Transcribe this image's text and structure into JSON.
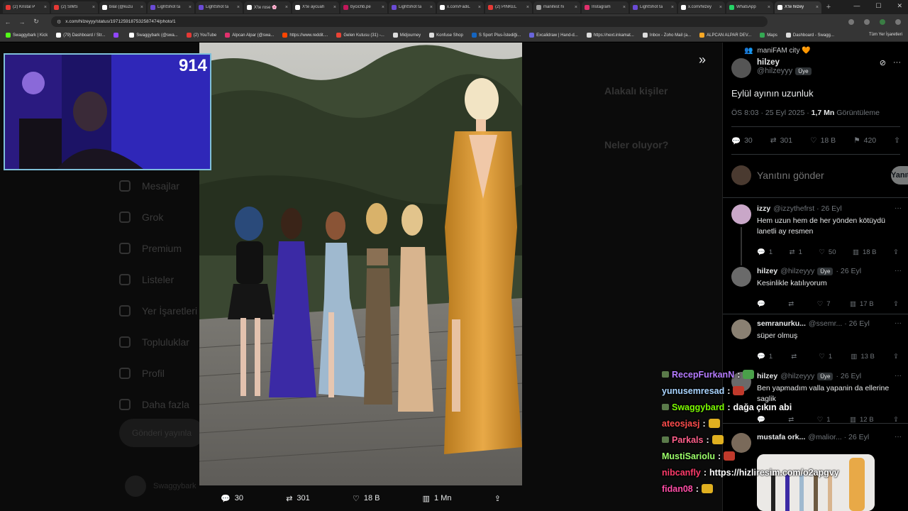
{
  "browser": {
    "tabs": [
      {
        "title": "(2) Kristal P",
        "color": "#e53935"
      },
      {
        "title": "(2) SIMS",
        "color": "#e53935"
      },
      {
        "title": "bilal (@kuzu",
        "color": "#ffffff"
      },
      {
        "title": "LightShot ta",
        "color": "#6a4bd6"
      },
      {
        "title": "LightShot ta",
        "color": "#6a4bd6"
      },
      {
        "title": "X'te rose 🌸",
        "color": "#ffffff"
      },
      {
        "title": "X'te aycuah",
        "color": "#ffffff"
      },
      {
        "title": "bycichb.pe",
        "color": "#c2185b"
      },
      {
        "title": "LightShot ta",
        "color": "#6a4bd6"
      },
      {
        "title": "x.com/FadiL",
        "color": "#ffffff"
      },
      {
        "title": "(2) PINKEL",
        "color": "#e53935"
      },
      {
        "title": "manifest hi",
        "color": "#9e9e9e"
      },
      {
        "title": "Instagram",
        "color": "#e1306c"
      },
      {
        "title": "LightShot ta",
        "color": "#6a4bd6"
      },
      {
        "title": "x.com/hilzey",
        "color": "#ffffff"
      },
      {
        "title": "WhatsApp",
        "color": "#25d366"
      },
      {
        "title": "X'te hilzey",
        "color": "#ffffff",
        "active": true
      }
    ],
    "url": "x.com/hilzeyyy/status/1971259187532587474/photo/1",
    "bookmarks": [
      {
        "label": "Swaggybark | Kick",
        "color": "#53fc18"
      },
      {
        "label": "(79) Dashboard / Str...",
        "color": "#ffffff"
      },
      {
        "label": "",
        "color": "#9146ff"
      },
      {
        "label": "Swaggybark (@swa...",
        "color": "#ffffff"
      },
      {
        "label": "(2) YouTube",
        "color": "#e53935"
      },
      {
        "label": "Alpcan Alpar (@swa...",
        "color": "#e1306c"
      },
      {
        "label": "https://www.reddit....",
        "color": "#ff4500"
      },
      {
        "label": "Gelen Kutusu (31) -...",
        "color": "#ea4335"
      },
      {
        "label": "Midjourney",
        "color": "#dddddd"
      },
      {
        "label": "Konfuse Shop",
        "color": "#dddddd"
      },
      {
        "label": "S Sport Plus-İstediği...",
        "color": "#1565c0"
      },
      {
        "label": "Excalidraw | Hand-d...",
        "color": "#6965db"
      },
      {
        "label": "https://next.inkamat...",
        "color": "#dddddd"
      },
      {
        "label": "Inbox - Zoho Mail (a...",
        "color": "#dddddd"
      },
      {
        "label": "ALPCAN ALPAR DEV...",
        "color": "#f9a825"
      },
      {
        "label": "Maps",
        "color": "#34a853"
      },
      {
        "label": "Dashboard - Swagg...",
        "color": "#dddddd"
      }
    ],
    "all_bookmarks": "Tüm Yer İşaretleri"
  },
  "background_nav": [
    "Mesajlar",
    "Grok",
    "Premium",
    "Listeler",
    "Yer İşaretleri",
    "Topluluklar",
    "Profil",
    "Daha fazla"
  ],
  "background_post_button": "Gönderi yayınla",
  "background_account": "Swaggybark",
  "background_right": {
    "related": "Alakalı kişiler",
    "trending": "Neler oluyor?"
  },
  "webcam": {
    "counter": "914"
  },
  "photo_bar": {
    "replies": "30",
    "reposts": "301",
    "likes": "18 B",
    "views": "1 Mn"
  },
  "tweet": {
    "community": "maniFAM city 🧡",
    "author_name": "hilzey",
    "author_handle": "@hilzeyyy",
    "member_badge": "Üye",
    "text": "Eylül ayının uzunluk",
    "time": "ÖS 8:03 · 25 Eyl 2025 · ",
    "views": "1,7 Mn",
    "views_label": " Görüntüleme",
    "replies": "30",
    "reposts": "301",
    "likes": "18 B",
    "bookmarks": "420",
    "reply_placeholder": "Yanıtını gönder",
    "reply_button": "Yanıtla"
  },
  "replies": [
    {
      "name": "izzy",
      "handle": "@izzythefrst · 26 Eyl",
      "text": "Hem uzun hem de her yönden kötüydü lanetli ay resmen",
      "replies": "1",
      "reposts": "1",
      "likes": "50",
      "views": "18 B",
      "avatar_color": "#c9a7c8"
    },
    {
      "name": "hilzey",
      "handle": "@hilzeyyy",
      "badge": "Üye",
      "date": "· 26 Eyl",
      "text": "Kesinlikle katılıyorum",
      "replies": "",
      "reposts": "",
      "likes": "7",
      "views": "17 B",
      "avatar_color": "#6a6a6a"
    },
    {
      "name": "semranurku...",
      "handle": "@ssemr... · 26 Eyl",
      "text": "süper olmuş",
      "replies": "1",
      "reposts": "",
      "likes": "1",
      "views": "13 B",
      "avatar_color": "#8a8072"
    },
    {
      "name": "hilzey",
      "handle": "@hilzeyyy",
      "badge": "Üye",
      "date": "· 26 Eyl",
      "text": "Ben yapmadım valla yapanin da ellerine saglik",
      "replies": "",
      "reposts": "",
      "likes": "1",
      "views": "12 B",
      "avatar_color": "#6a6a6a"
    },
    {
      "name": "mustafa ork...",
      "handle": "@malior... · 26 Eyl",
      "text": "",
      "avatar_color": "#7a6a5a"
    }
  ],
  "chat": [
    {
      "user": "RecepFurkanN",
      "color": "#b57bff",
      "msg": "",
      "emote": "#4aa04a",
      "badge": true
    },
    {
      "user": "yunusemresad",
      "color": "#a9d4ff",
      "msg": "",
      "emote": "#c0392b",
      "badge": false
    },
    {
      "user": "Swaggybard",
      "color": "#7cfc00",
      "msg": "dağa çıkın abi",
      "emote": "",
      "badge": true
    },
    {
      "user": "ateosjasj",
      "color": "#ff4d4d",
      "msg": "",
      "emote": "#e0b020",
      "badge": false
    },
    {
      "user": "Parkals",
      "color": "#ff5f8a",
      "msg": "",
      "emote": "#e0b020",
      "badge": true
    },
    {
      "user": "MustiSariolu",
      "color": "#9cff6a",
      "msg": "",
      "emote": "#c0392b",
      "badge": false
    },
    {
      "user": "nibcanfly",
      "color": "#ff3b6b",
      "msg": "https://hizliresim.com/o2apgvy",
      "emote": "",
      "badge": false
    },
    {
      "user": "fidan08",
      "color": "#ff4da6",
      "msg": "",
      "emote": "#e0b020",
      "badge": false
    }
  ],
  "colors": {
    "bg": "#000000",
    "muted": "#71767b",
    "text": "#e7e9ea",
    "border": "#2f3336",
    "webcam_border": "#7fbfd9"
  }
}
